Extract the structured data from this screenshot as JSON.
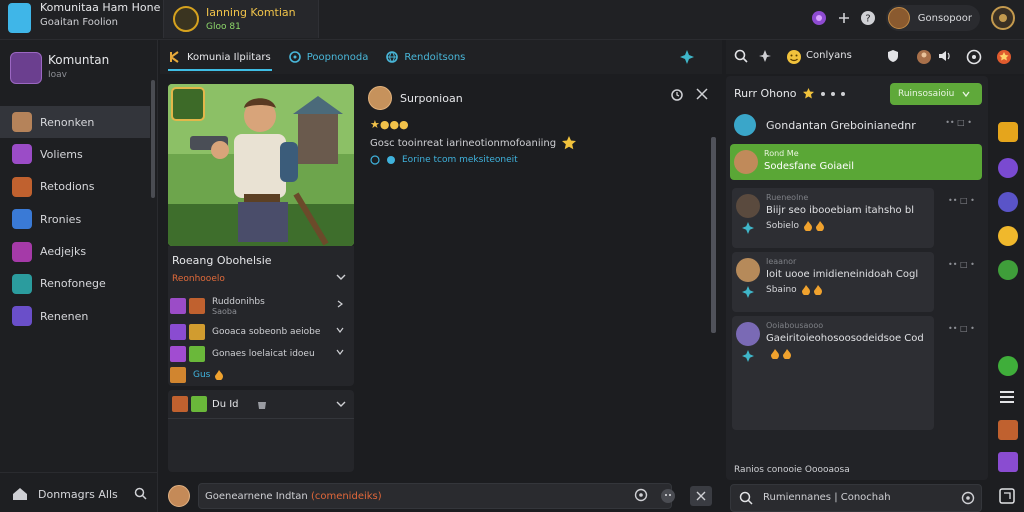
{
  "topbar": {
    "brand_title": "Komunitaa Ham Hone",
    "brand_subtitle": "Goaitan  Foolion",
    "server_name": "Ianning  Komtian",
    "server_status": "Gloo  81",
    "user_name": "Gonsopoor"
  },
  "sidebar": {
    "header_title": "Komuntan",
    "header_subtitle": "Ioav",
    "items": [
      {
        "label": "Renonken",
        "active": true,
        "color": "#b5835a"
      },
      {
        "label": "Voliems",
        "active": false,
        "color": "#9b4cc7"
      },
      {
        "label": "Retodions",
        "active": false,
        "color": "#c0612f"
      },
      {
        "label": "Rronies",
        "active": false,
        "color": "#3a7ad6"
      },
      {
        "label": "Aedjejks",
        "active": false,
        "color": "#a53aa8"
      },
      {
        "label": "Renofonege",
        "active": false,
        "color": "#2b9c9e"
      },
      {
        "label": "Renenen",
        "active": false,
        "color": "#6a4fc9"
      }
    ],
    "footer_label": "Donmagrs Alls"
  },
  "tabs": [
    {
      "label": "Komunia Ilpiitars",
      "active": true
    },
    {
      "label": "Poopnonoda",
      "active": false
    },
    {
      "label": "Rendoitsons",
      "active": false
    }
  ],
  "right_tools": {
    "label": "Conlyans"
  },
  "card": {
    "title": "Roeang Obohelsie",
    "meta": "Reonhooelo",
    "mods": [
      {
        "label": "Ruddonihbs",
        "sub": "Saoba"
      },
      {
        "label": "Gooaca sobeonb aeiobe"
      },
      {
        "label": "Gonaes loelaicat idoeu"
      },
      {
        "label": "Gus"
      }
    ],
    "footer_label": "Du Id"
  },
  "post": {
    "author": "Surponioan",
    "reactions": "★●●●",
    "text": "Gosc tooinreat iarineotionmofoaniing",
    "link": "Eorine tcom meksiteoneit"
  },
  "composer": {
    "value": "Goenearnene Indtan ",
    "highlight": "(comenideiks)"
  },
  "chat": {
    "title": "Rurr Ohono",
    "join_label": "Ruinsosaioiu",
    "pinned": "Gondantan Greboinianednr",
    "pinned_tools": "••   □   •",
    "highlight": {
      "name": "Rond Me",
      "text": "Sodesfane Goiaeil"
    },
    "messages": [
      {
        "name": "Rueneolne",
        "text": "Biijr seo ibooebiam itahsho bl",
        "reacts": "Sobielo",
        "color": "#5a4a3e"
      },
      {
        "name": "Ieaanor",
        "text": "Ioit uooe imidieneinidoah Cogl",
        "reacts": "Sbaino",
        "color": "#b68a5a"
      },
      {
        "name": "Ooiabousaooo",
        "text": "Gaeiritoieohosoosodeidsoe Cod",
        "reacts": "",
        "color": "#7a6ab5"
      }
    ],
    "typing": "Ranios conooie Ooooaosa",
    "input_value": "Rumiennanes | Conochah"
  }
}
